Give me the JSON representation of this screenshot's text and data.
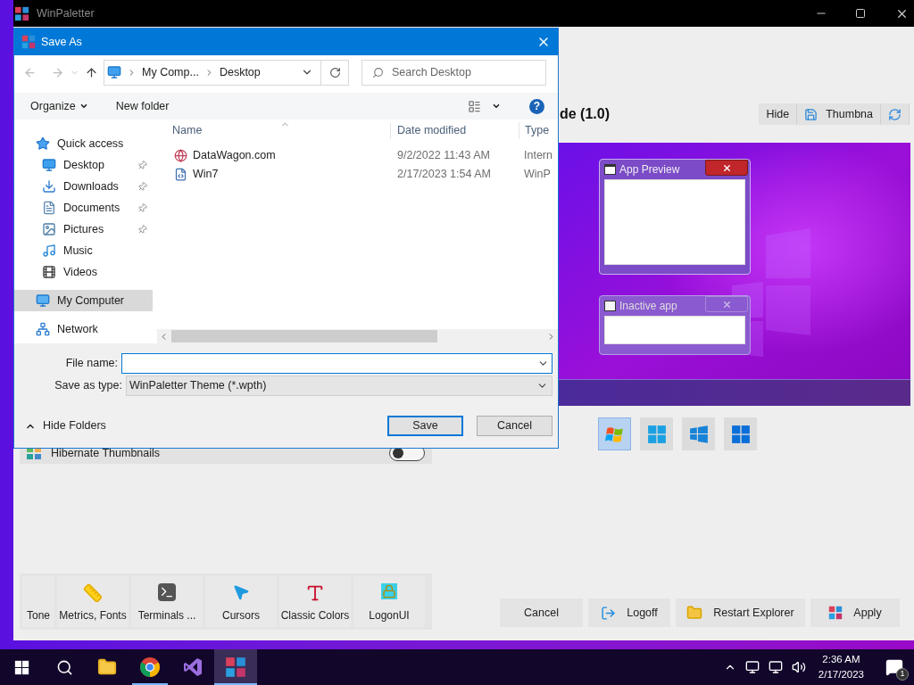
{
  "main_window": {
    "title": "WinPaletter",
    "preview_title": "de (1.0)",
    "toolbar": [
      {
        "label": "Hide",
        "kind": "text"
      },
      {
        "label": "Thumbna",
        "kind": "save"
      },
      {
        "kind": "refresh"
      }
    ],
    "preview_windows": [
      {
        "title": "App Preview",
        "active": true
      },
      {
        "title": "Inactive app",
        "active": false
      }
    ],
    "styles": [
      {
        "kind": "win7",
        "selected": true
      },
      {
        "kind": "win8",
        "selected": false
      },
      {
        "kind": "win10",
        "selected": false
      },
      {
        "kind": "win11",
        "selected": false
      }
    ],
    "hibernate": {
      "label": "Hibernate Thumbnails",
      "on": false
    },
    "tabs": [
      {
        "label": "Tone",
        "kind": "partial"
      },
      {
        "label": "Metrics, Fonts",
        "kind": "ruler"
      },
      {
        "label": "Terminals ...",
        "kind": "terminal"
      },
      {
        "label": "Cursors",
        "kind": "cursor"
      },
      {
        "label": "Classic Colors",
        "kind": "colors"
      },
      {
        "label": "LogonUI",
        "kind": "lock"
      }
    ],
    "actions": [
      {
        "label": "Cancel",
        "kind": "plain"
      },
      {
        "label": "Logoff",
        "kind": "logoff"
      },
      {
        "label": "Restart Explorer",
        "kind": "folder"
      },
      {
        "label": "Apply",
        "kind": "apply"
      }
    ]
  },
  "dialog": {
    "title": "Save As",
    "path": [
      "My Comp...",
      "Desktop"
    ],
    "search_placeholder": "Search Desktop",
    "organize": "Organize",
    "new_folder": "New folder",
    "help": "?",
    "nav": [
      {
        "label": "Quick access",
        "kind": "star",
        "pinned": false,
        "selected": false,
        "children": [
          {
            "label": "Desktop",
            "kind": "desktop",
            "pinned": true,
            "selected": false
          },
          {
            "label": "Downloads",
            "kind": "download",
            "pinned": true,
            "selected": false
          },
          {
            "label": "Documents",
            "kind": "document",
            "pinned": true,
            "selected": false
          },
          {
            "label": "Pictures",
            "kind": "picture",
            "pinned": true,
            "selected": false
          },
          {
            "label": "Music",
            "kind": "music",
            "pinned": false,
            "selected": false
          },
          {
            "label": "Videos",
            "kind": "video",
            "pinned": false,
            "selected": false
          }
        ]
      },
      {
        "label": "My Computer",
        "kind": "computer",
        "pinned": false,
        "selected": true
      },
      {
        "label": "Network",
        "kind": "network",
        "pinned": false,
        "selected": false
      }
    ],
    "columns": [
      "Name",
      "Date modified",
      "Type"
    ],
    "files": [
      {
        "name": "DataWagon.com",
        "date": "9/2/2022 11:43 AM",
        "type": "Intern",
        "kind": "link"
      },
      {
        "name": "Win7",
        "date": "2/17/2023 1:54 AM",
        "type": "WinP",
        "kind": "theme"
      }
    ],
    "file_name_label": "File name:",
    "type_label": "Save as type:",
    "type_value": "WinPaletter Theme (*.wpth)",
    "hide_folders": "Hide Folders",
    "buttons": [
      {
        "label": "Save",
        "default": true
      },
      {
        "label": "Cancel",
        "default": false
      }
    ]
  },
  "taskbar": {
    "apps": [
      {
        "kind": "start",
        "running": false,
        "active": false
      },
      {
        "kind": "search",
        "running": false,
        "active": false
      },
      {
        "kind": "explorer",
        "running": false,
        "active": false
      },
      {
        "kind": "chrome",
        "running": true,
        "active": false
      },
      {
        "kind": "studio",
        "running": false,
        "active": false
      },
      {
        "kind": "palette",
        "running": true,
        "active": true
      }
    ],
    "time": "2:36 AM",
    "date": "2/17/2023",
    "notifications": "1"
  }
}
